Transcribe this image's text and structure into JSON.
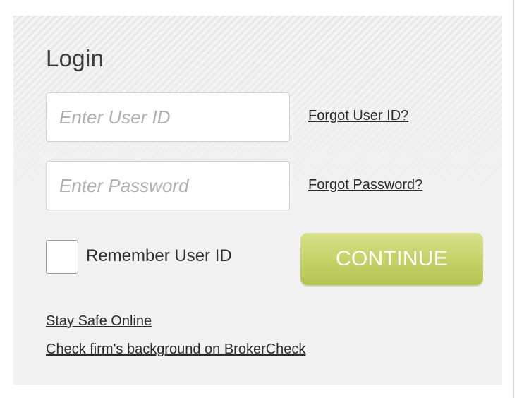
{
  "login": {
    "title": "Login",
    "user_id_placeholder": "Enter User ID",
    "user_id_value": "",
    "password_placeholder": "Enter Password",
    "password_value": "",
    "forgot_user_id": "Forgot User ID?",
    "forgot_password": "Forgot Password?",
    "remember_label": "Remember User ID",
    "remember_checked": false,
    "continue_label": "CONTINUE",
    "continue_color": "#c2d165"
  },
  "footer_links": {
    "stay_safe": "Stay Safe Online",
    "broker_check": "Check firm's background on BrokerCheck"
  }
}
